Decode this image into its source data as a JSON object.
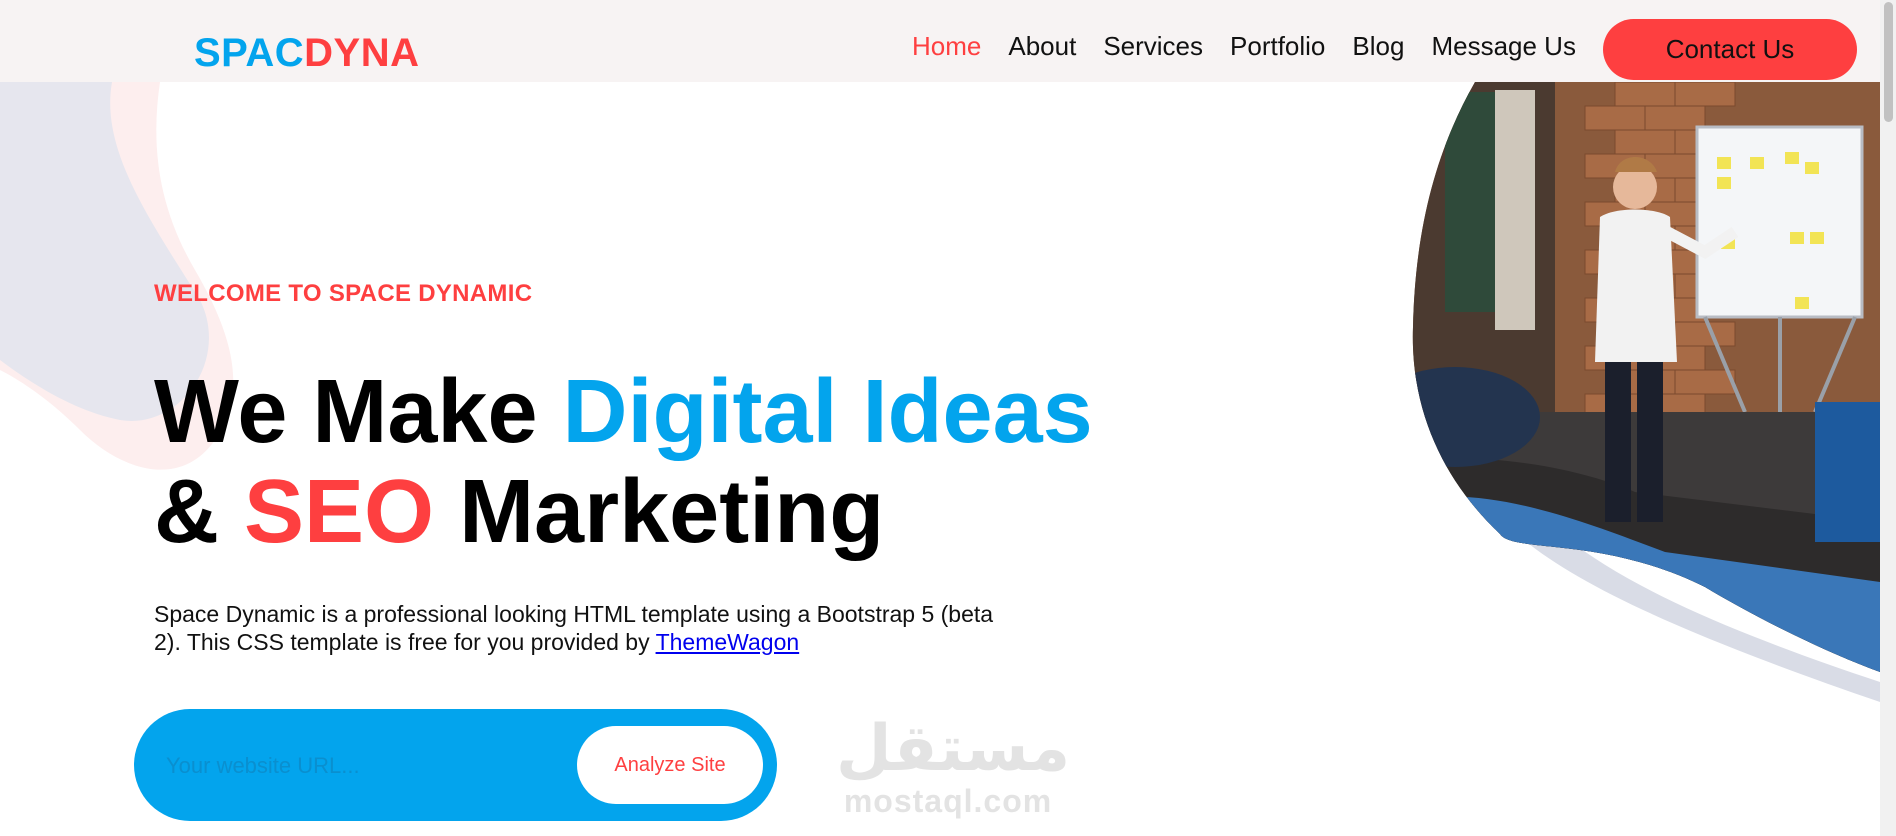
{
  "theme": {
    "blue": "#03a4ed",
    "red": "#fe3f40"
  },
  "navbar": {
    "logo_part1": "SPAC",
    "logo_part2": "DYNA",
    "links": [
      {
        "label": "Home",
        "active": true
      },
      {
        "label": "About"
      },
      {
        "label": "Services"
      },
      {
        "label": "Portfolio"
      },
      {
        "label": "Blog"
      },
      {
        "label": "Message Us"
      }
    ],
    "contact_label": "Contact Us"
  },
  "hero": {
    "eyebrow": "WELCOME TO SPACE DYNAMIC",
    "headline": {
      "part1": "We Make ",
      "part2": "Digital Ideas",
      "part3": "& ",
      "part4": "SEO",
      "part5": " Marketing"
    },
    "description": "Space Dynamic is a professional looking HTML template using a Bootstrap 5 (beta 2). This CSS template is free for you provided by ",
    "link_text": "ThemeWagon",
    "photo_icon": "team-meeting-photo"
  },
  "search": {
    "placeholder": "Your website URL...",
    "value": "",
    "button_label": "Analyze Site"
  },
  "watermark": {
    "arabic": "مستقل",
    "latin": "mostaql.com"
  }
}
